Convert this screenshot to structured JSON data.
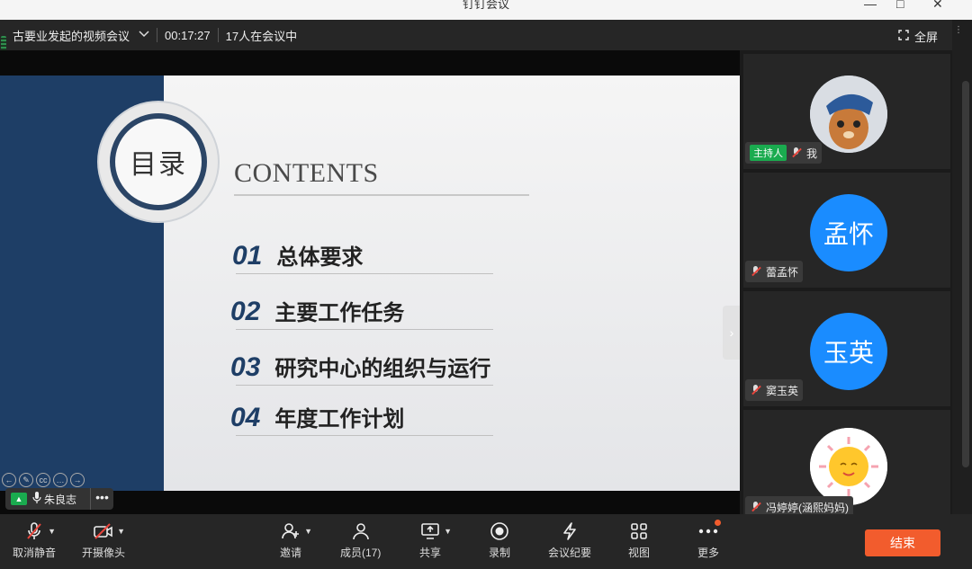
{
  "window": {
    "title": "钉钉会议",
    "minimize": "—",
    "restore": "□",
    "close": "✕"
  },
  "meeting": {
    "title": "古要业发起的视频会议",
    "duration": "00:17:27",
    "participants_text": "17人在会议中",
    "fullscreen_label": "全屏"
  },
  "slide": {
    "circle_text": "目录",
    "contents_heading": "CONTENTS",
    "items": [
      {
        "num": "01",
        "text": "总体要求"
      },
      {
        "num": "02",
        "text": "主要工作任务"
      },
      {
        "num": "03",
        "text": "研究中心的组织与运行"
      },
      {
        "num": "04",
        "text": "年度工作计划"
      }
    ]
  },
  "speaker": {
    "name": "朱良志",
    "more": "•••"
  },
  "participants": [
    {
      "host_badge": "主持人",
      "name": "我",
      "avatar_text": "",
      "avatar_color": "#c9d6e6"
    },
    {
      "name": "蕾孟怀",
      "avatar_text": "孟怀",
      "avatar_color": "#1a8cff"
    },
    {
      "name": "窦玉英",
      "avatar_text": "玉英",
      "avatar_color": "#1a8cff"
    },
    {
      "name": "冯婷婷(涵熙妈妈)",
      "avatar_text": "",
      "avatar_color": "#ffffff"
    }
  ],
  "toolbar": {
    "mute": "取消静音",
    "camera": "开摄像头",
    "invite": "邀请",
    "members": "成员(17)",
    "share": "共享",
    "record": "录制",
    "minutes": "会议纪要",
    "view": "视图",
    "more": "更多",
    "end": "结束"
  },
  "colors": {
    "accent": "#1aab4f",
    "end": "#f25c2d",
    "slide_blue": "#1e3e66"
  }
}
